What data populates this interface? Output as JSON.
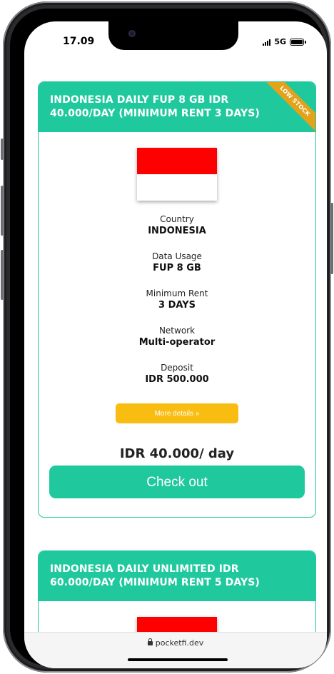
{
  "status": {
    "time": "17.09",
    "network": "5G"
  },
  "cards": [
    {
      "title": "INDONESIA DAILY FUP 8 GB IDR 40.000/DAY (MINIMUM RENT 3 DAYS)",
      "badge": "LOW STOCK",
      "fields": [
        {
          "label": "Country",
          "value": "INDONESIA"
        },
        {
          "label": "Data Usage",
          "value": "FUP 8 GB"
        },
        {
          "label": "Minimum Rent",
          "value": "3 DAYS"
        },
        {
          "label": "Network",
          "value": "Multi-operator"
        },
        {
          "label": "Deposit",
          "value": "IDR 500.000"
        }
      ],
      "more_label": "More details »",
      "price": "IDR 40.000/ day",
      "checkout_label": "Check out"
    },
    {
      "title": "INDONESIA DAILY UNLIMITED IDR 60.000/DAY (MINIMUM RENT 5 DAYS)"
    }
  ],
  "browser": {
    "url": "pocketfi.dev"
  },
  "colors": {
    "accent": "#1fc99d",
    "button_yellow": "#f9bd12",
    "badge": "#e3a21a",
    "flag_red": "#ff0000"
  }
}
